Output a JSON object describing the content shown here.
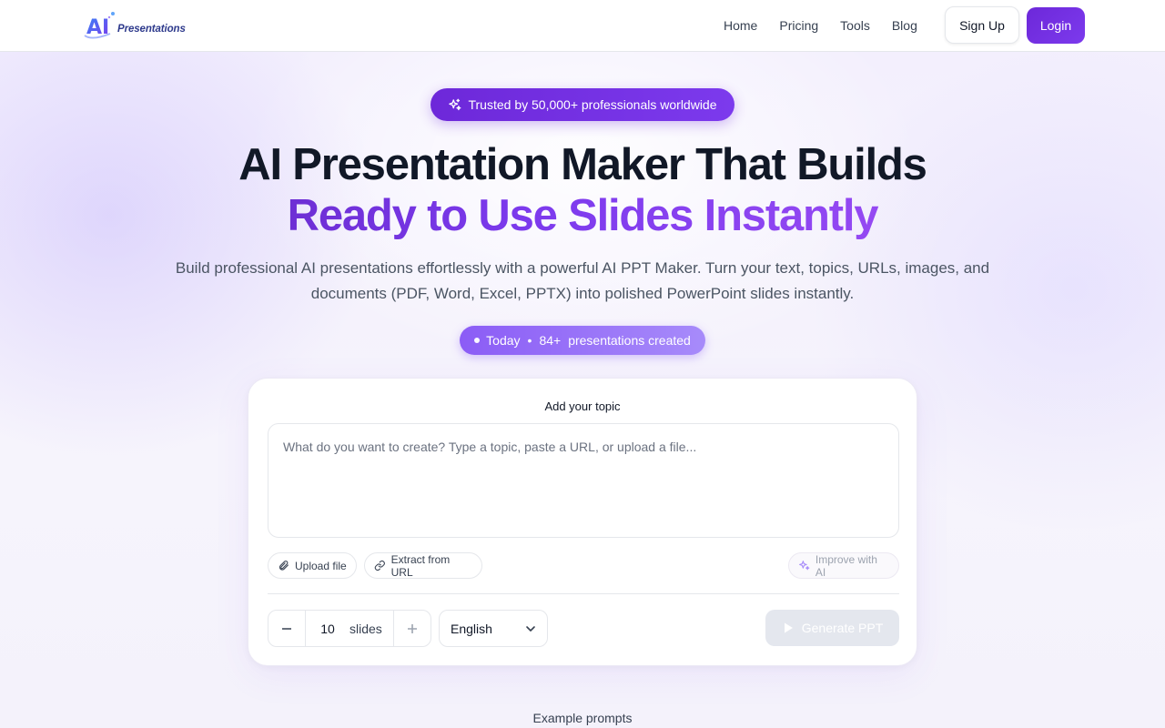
{
  "brand": {
    "logo_text": "Presentations",
    "logo_mark": "AI"
  },
  "nav": {
    "links": [
      "Home",
      "Pricing",
      "Tools",
      "Blog"
    ],
    "signup_label": "Sign Up",
    "login_label": "Login"
  },
  "hero": {
    "trust_badge": "Trusted by 50,000+ professionals worldwide",
    "title_line1": "AI Presentation Maker That Builds",
    "title_line2": "Ready to Use Slides Instantly",
    "subtitle": "Build professional AI presentations effortlessly with a powerful AI PPT Maker. Turn your text, topics, URLs, images, and documents (PDF, Word, Excel, PPTX) into polished PowerPoint slides instantly.",
    "stat": {
      "prefix": "Today",
      "count": "84+",
      "suffix": "presentations created"
    }
  },
  "form": {
    "title": "Add your topic",
    "topic_placeholder": "What do you want to create? Type a topic, paste a URL, or upload a file...",
    "upload_label": "Upload file",
    "extract_label": "Extract from URL",
    "improve_label": "Improve with AI",
    "slides_value": "10",
    "slides_unit": "slides",
    "language": "English",
    "generate_label": "Generate PPT"
  },
  "examples_heading": "Example prompts",
  "colors": {
    "primary": "#6d28d9",
    "accent": "#8b5cf6",
    "disabled": "#e4e7ee"
  }
}
